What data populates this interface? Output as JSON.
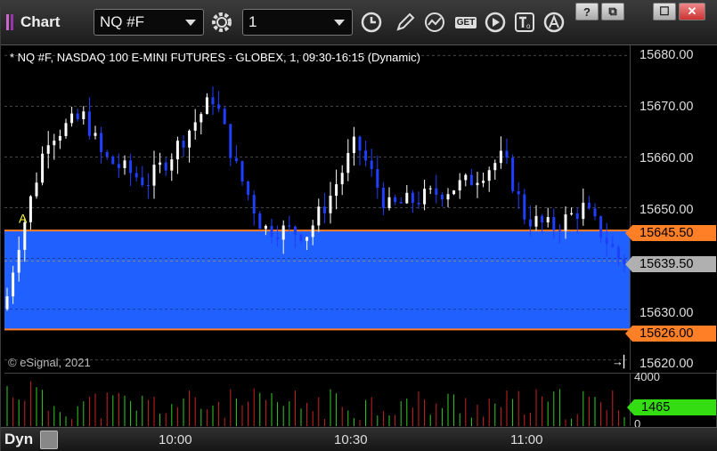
{
  "app": {
    "title": "Chart"
  },
  "toolbar": {
    "symbol": "NQ #F",
    "interval": "1",
    "get_label": "GET"
  },
  "window_buttons": {
    "help": "?",
    "restore": "⧉",
    "maximize": "☐",
    "close": "✕"
  },
  "chart": {
    "description": "* NQ #F, NASDAQ 100 E-MINI FUTURES - GLOBEX, 1, 09:30-16:15 (Dynamic)",
    "copyright": "© eSignal, 2021",
    "marker": "A",
    "colors": {
      "up": "#ffffff",
      "down": "#1f3fff",
      "band": "#2060ff",
      "band_edge": "#ff7f27",
      "last": "#b0b0b0"
    }
  },
  "price_axis": {
    "labels": [
      "15680.00",
      "15670.00",
      "15660.00",
      "15650.00",
      "15630.00",
      "15620.00"
    ],
    "upper_band": "15645.50",
    "last_price": "15639.50",
    "lower_band": "15626.00"
  },
  "volume_axis": {
    "top": "4000",
    "last": "1465",
    "bottom": "0"
  },
  "time_axis": {
    "labels": [
      "10:00",
      "10:30",
      "11:00"
    ]
  },
  "bottom": {
    "mode": "Dyn"
  },
  "chart_data": {
    "type": "candlestick",
    "ylim": [
      15618,
      15682
    ],
    "band": {
      "upper": 15645.5,
      "lower": 15626.0
    },
    "last": 15639.5,
    "volume_ylim": [
      0,
      4000
    ]
  }
}
